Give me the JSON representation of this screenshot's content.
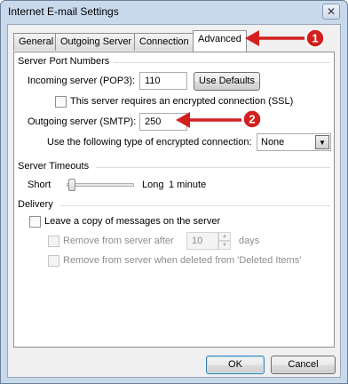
{
  "window": {
    "title": "Internet E-mail Settings",
    "close_glyph": "✕"
  },
  "tabs": [
    {
      "label": "General"
    },
    {
      "label": "Outgoing Server"
    },
    {
      "label": "Connection"
    },
    {
      "label": "Advanced"
    }
  ],
  "server_port": {
    "header": "Server Port Numbers",
    "incoming_label": "Incoming server (POP3):",
    "incoming_value": "110",
    "use_defaults": "Use Defaults",
    "ssl_label": "This server requires an encrypted connection (SSL)",
    "outgoing_label": "Outgoing server (SMTP):",
    "outgoing_value": "250",
    "encryption_label": "Use the following type of encrypted connection:",
    "encryption_value": "None"
  },
  "timeouts": {
    "header": "Server Timeouts",
    "short": "Short",
    "long": "Long",
    "value": "1 minute"
  },
  "delivery": {
    "header": "Delivery",
    "leave_copy": "Leave a copy of messages on the server",
    "remove_after": "Remove from server after",
    "days_value": "10",
    "days_label": "days",
    "remove_deleted": "Remove from server when deleted from 'Deleted Items'"
  },
  "buttons": {
    "ok": "OK",
    "cancel": "Cancel"
  },
  "annotations": {
    "marker1": "1",
    "marker2": "2"
  },
  "colors": {
    "arrow_red": "#d21f1f"
  }
}
